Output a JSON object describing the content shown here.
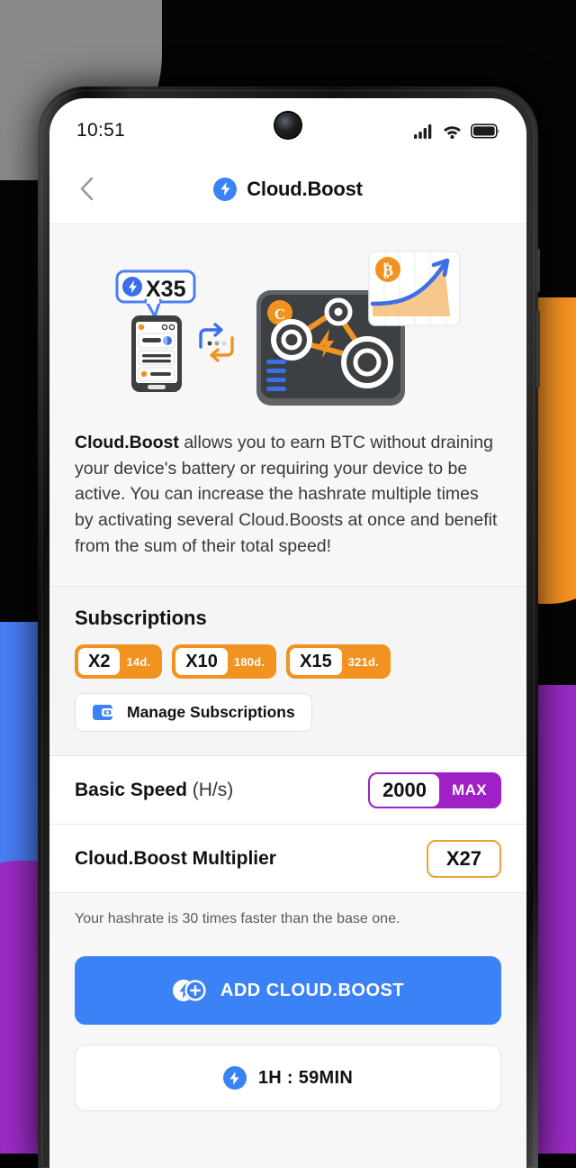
{
  "status_bar": {
    "time": "10:51",
    "icons": [
      "signal-icon",
      "wifi-icon",
      "battery-icon"
    ]
  },
  "nav": {
    "back_icon": "chevron-left-icon",
    "brand_icon": "bolt-icon",
    "title": "Cloud.Boost"
  },
  "hero": {
    "bubble_multiplier": "X35",
    "bubble_icon": "bolt-icon",
    "phone_icon": "smartphone-illustration",
    "sync_icon": "sync-arrows-icon",
    "miner_icon": "mining-rig-illustration",
    "coin_icon": "bitcoin-icon",
    "chart_icon": "growth-chart-illustration"
  },
  "description": {
    "bold_lead": "Cloud.Boost",
    "rest": " allows you to earn BTC without draining your device's battery or requiring your device to be active. You can increase the hashrate multiple times by activating several Cloud.Boosts at once and benefit from the sum of their total speed!"
  },
  "subscriptions": {
    "title": "Subscriptions",
    "items": [
      {
        "multiplier": "X2",
        "days": "14d."
      },
      {
        "multiplier": "X10",
        "days": "180d."
      },
      {
        "multiplier": "X15",
        "days": "321d."
      }
    ],
    "manage": {
      "icon": "wallet-icon",
      "label": "Manage Subscriptions"
    }
  },
  "stats": {
    "basic_speed": {
      "label": "Basic Speed",
      "unit": "(H/s)",
      "value": "2000",
      "badge": "MAX"
    },
    "multiplier": {
      "label": "Cloud.Boost Multiplier",
      "value": "X27"
    },
    "note": "Your hashrate is 30 times faster than the base one."
  },
  "actions": {
    "add_boost": {
      "icon": "bolt-plus-icon",
      "label": "ADD CLOUD.BOOST"
    },
    "timer": {
      "icon": "bolt-icon",
      "label": "1H : 59MIN"
    }
  },
  "colors": {
    "accent_blue": "#3b82f6",
    "orange": "#f29220",
    "purple": "#a020c8",
    "multiplier_border": "#f0a037"
  }
}
